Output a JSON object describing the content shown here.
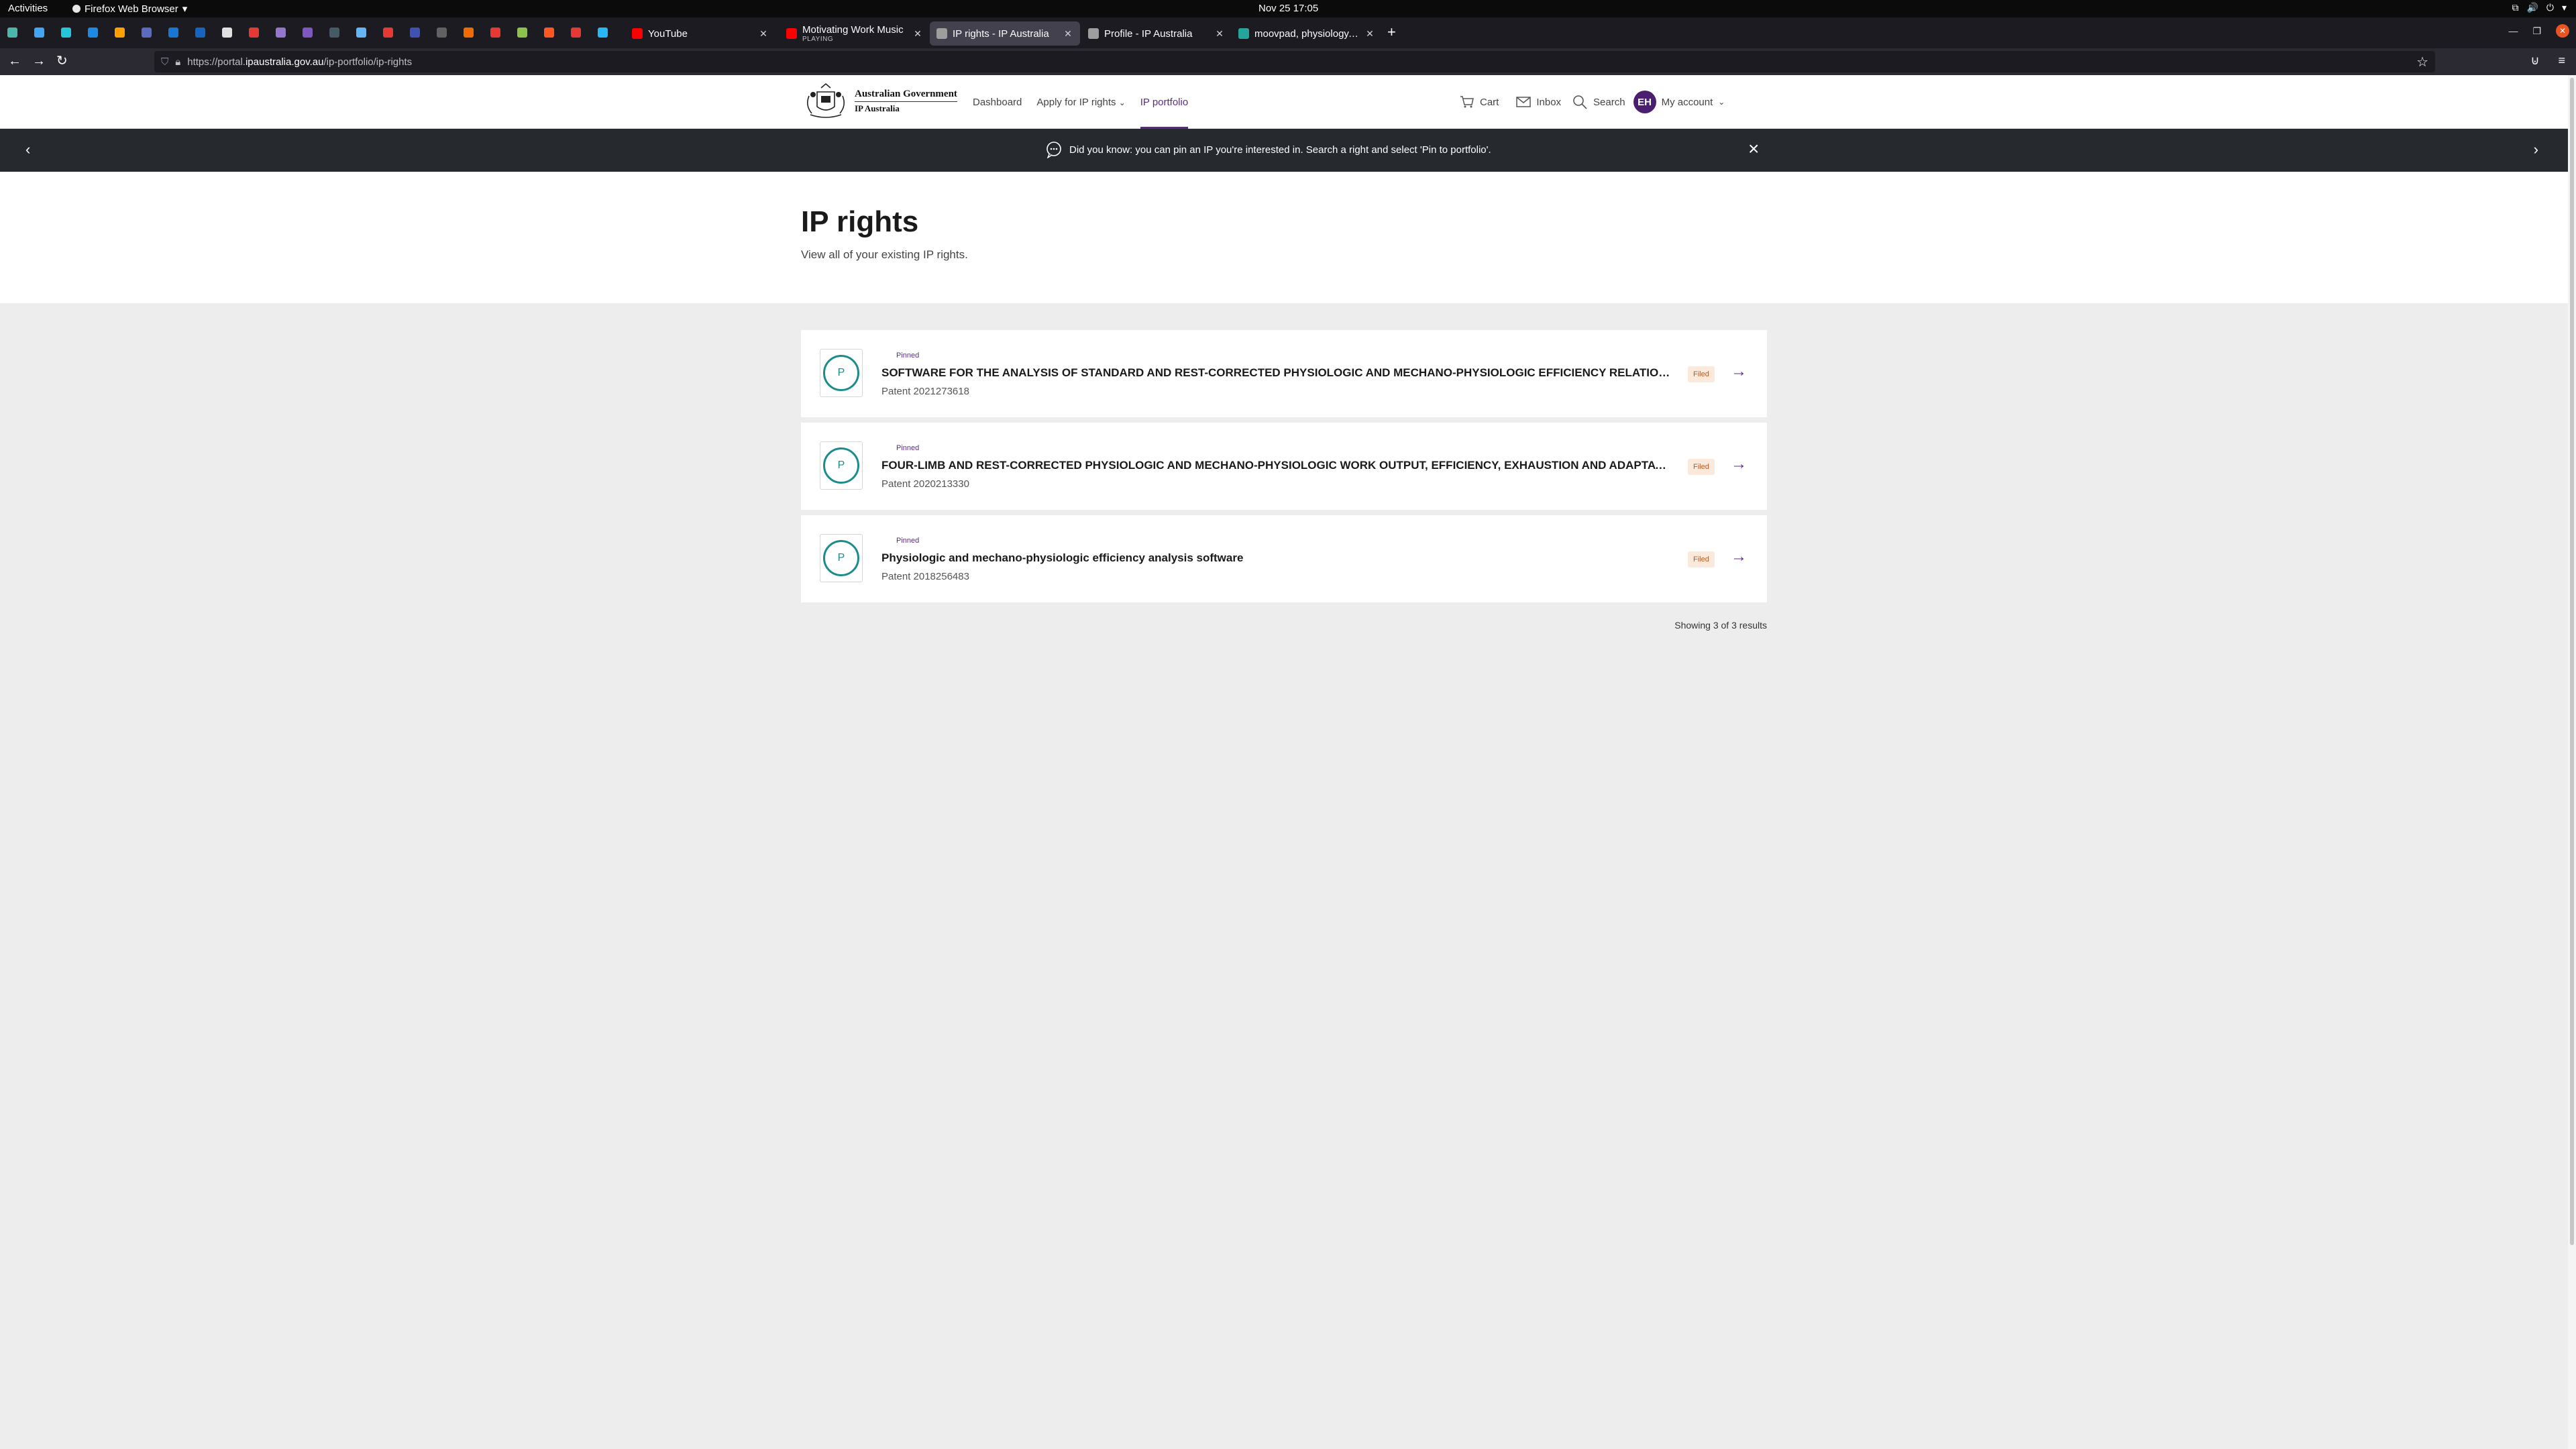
{
  "system_bar": {
    "activities": "Activities",
    "app_name": "Firefox Web Browser",
    "clock": "Nov 25  17:05"
  },
  "browser": {
    "pinned_tab_colors": [
      "#4db6ac",
      "#42a5f5",
      "#26c6da",
      "#1e88e5",
      "#ffa000",
      "#5c6bc0",
      "#1976d2",
      "#1565c0",
      "#e0e0e0",
      "#e53935",
      "#9575cd",
      "#7e57c2",
      "#455a64",
      "#64b5f6",
      "#e53935",
      "#3f51b5",
      "#616161",
      "#ef6c00",
      "#e53935",
      "#8bc34a",
      "#ff5722",
      "#e53935",
      "#29b6f6"
    ],
    "tabs": [
      {
        "title": "YouTube",
        "subtitle": "",
        "favicon_color": "#ff0000"
      },
      {
        "title": "Motivating Work Music",
        "subtitle": "PLAYING",
        "favicon_color": "#ff0000"
      },
      {
        "title": "IP rights - IP Australia",
        "subtitle": "",
        "favicon_color": "#9e9e9e"
      },
      {
        "title": "Profile - IP Australia",
        "subtitle": "",
        "favicon_color": "#9e9e9e"
      },
      {
        "title": "moovpad, physiology, ph",
        "subtitle": "",
        "favicon_color": "#26a69a"
      }
    ],
    "url_prefix": "https://portal.",
    "url_host": "ipaustralia.gov.au",
    "url_path": "/ip-portfolio/ip-rights"
  },
  "header": {
    "logo_line1": "Australian Government",
    "logo_line2": "IP Australia",
    "nav": {
      "dashboard": "Dashboard",
      "apply": "Apply for IP rights",
      "portfolio": "IP portfolio"
    },
    "cart": "Cart",
    "inbox": "Inbox",
    "search": "Search",
    "avatar_initials": "EH",
    "account": "My account"
  },
  "banner": {
    "message": "Did you know: you can pin an IP you're interested in. Search a right and select 'Pin to portfolio'."
  },
  "main": {
    "title": "IP rights",
    "subtitle": "View all of your existing IP rights.",
    "rights": [
      {
        "badge": "Pinned",
        "icon_letter": "P",
        "title": "SOFTWARE FOR THE ANALYSIS OF STANDARD AND REST-CORRECTED PHYSIOLOGIC AND MECHANO-PHYSIOLOGIC EFFICIENCY RELATIONS",
        "number": "Patent 2021273618",
        "status": "Filed"
      },
      {
        "badge": "Pinned",
        "icon_letter": "P",
        "title": "FOUR-LIMB AND REST-CORRECTED PHYSIOLOGIC AND MECHANO-PHYSIOLOGIC WORK OUTPUT, EFFICIENCY, EXHAUSTION AND ADAPTATION AN...",
        "number": "Patent 2020213330",
        "status": "Filed"
      },
      {
        "badge": "Pinned",
        "icon_letter": "P",
        "title": "Physiologic and mechano-physiologic efficiency analysis software",
        "number": "Patent 2018256483",
        "status": "Filed"
      }
    ],
    "results_text": "Showing 3 of 3 results"
  },
  "colors": {
    "brand_purple": "#5b2a86",
    "teal": "#1a8c8c",
    "banner_bg": "#262a2f",
    "status_bg": "#fbe9dc"
  }
}
